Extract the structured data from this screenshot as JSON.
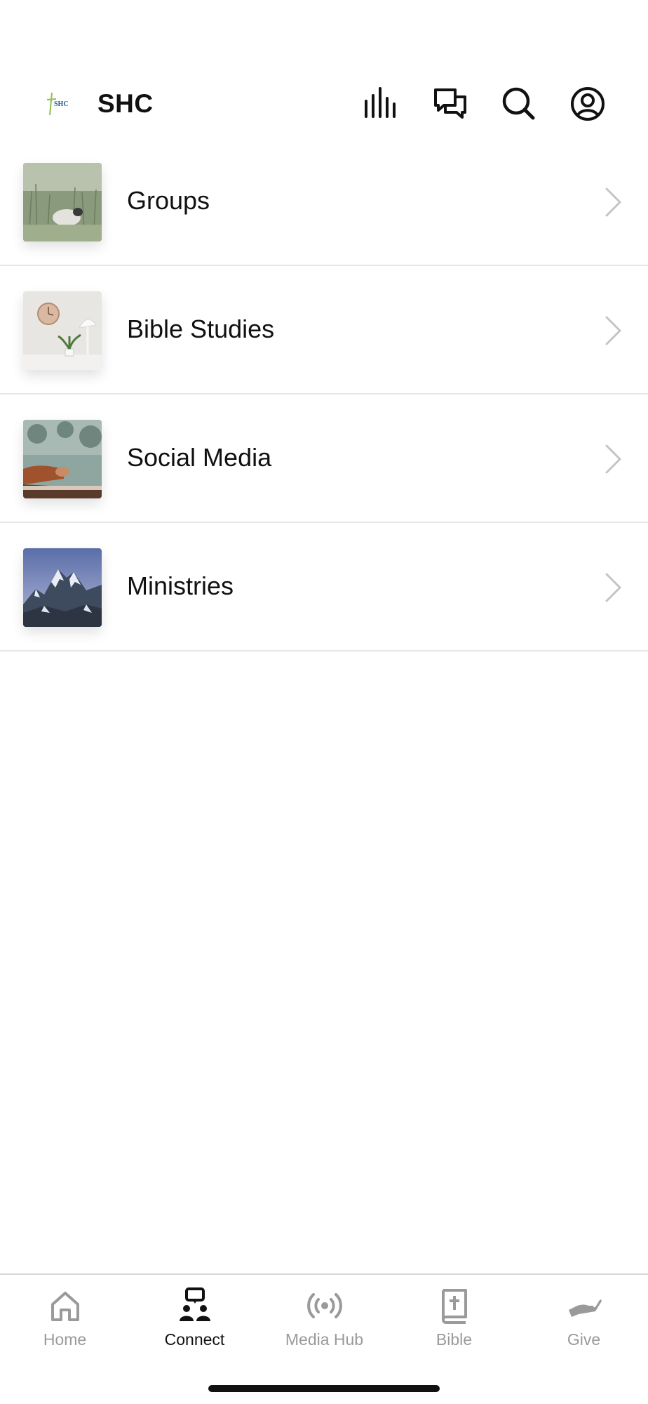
{
  "header": {
    "logo_text": "SHC",
    "title": "SHC",
    "icons": [
      "stats-icon",
      "chat-icon",
      "search-icon",
      "profile-icon"
    ]
  },
  "list": {
    "items": [
      {
        "label": "Groups",
        "image": "sheep-in-grass-photo"
      },
      {
        "label": "Bible Studies",
        "image": "clock-and-lamp-photo"
      },
      {
        "label": "Social Media",
        "image": "praying-hands-photo"
      },
      {
        "label": "Ministries",
        "image": "snowy-mountain-photo"
      }
    ]
  },
  "tabbar": {
    "active_tab": "Connect",
    "tabs": [
      {
        "label": "Home",
        "icon": "home-icon"
      },
      {
        "label": "Connect",
        "icon": "connect-icon"
      },
      {
        "label": "Media Hub",
        "icon": "broadcast-icon"
      },
      {
        "label": "Bible",
        "icon": "bible-icon"
      },
      {
        "label": "Give",
        "icon": "give-hand-icon"
      }
    ]
  },
  "colors": {
    "text": "#111111",
    "inactive": "#9a9a9a",
    "divider": "#e6e6e6",
    "chevron": "#c4c4c4"
  }
}
